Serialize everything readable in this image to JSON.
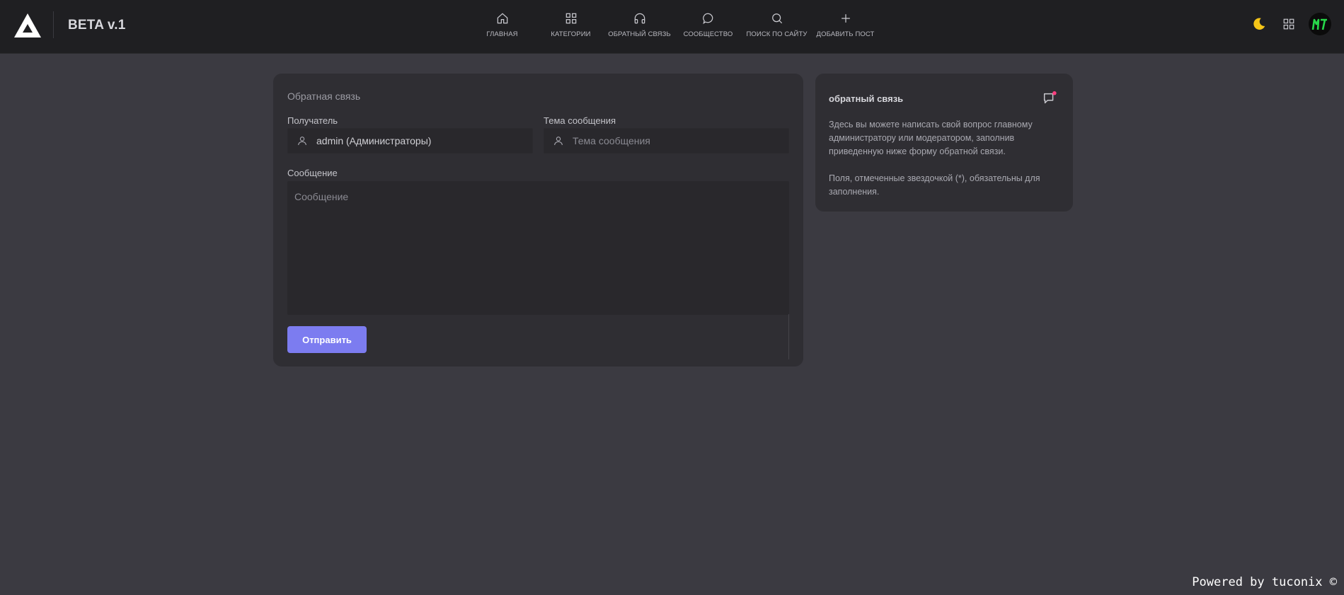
{
  "header": {
    "brand": "BETA v.1",
    "nav": [
      {
        "label": "ГЛАВНАЯ",
        "icon": "home-icon"
      },
      {
        "label": "КАТЕГОРИИ",
        "icon": "grid-icon"
      },
      {
        "label": "ОБРАТНЫЙ СВЯЗЬ",
        "icon": "headphones-icon"
      },
      {
        "label": "СООБЩЕСТВО",
        "icon": "chat-bubble-icon"
      },
      {
        "label": "ПОИСК ПО САЙТУ",
        "icon": "search-icon"
      },
      {
        "label": "ДОБАВИТЬ ПОСТ",
        "icon": "plus-icon"
      }
    ],
    "tools": [
      "moon-icon",
      "apps-grid-icon",
      "avatar"
    ]
  },
  "form": {
    "title": "Обратная связь",
    "recipient_label": "Получатель",
    "recipient_value": "admin (Администраторы)",
    "subject_label": "Тема сообщения",
    "subject_placeholder": "Тема сообщения",
    "message_label": "Сообщение",
    "message_placeholder": "Сообщение",
    "submit_label": "Отправить"
  },
  "side": {
    "title": "обратный связь",
    "paragraph1": "Здесь вы можете написать свой вопрос главному администратору или модератором, заполнив приведенную ниже форму обратной связи.",
    "paragraph2": "Поля, отмеченные звездочкой (*), обязательны для заполнения."
  },
  "footer": {
    "powered": "Powered by tuconix ©"
  },
  "colors": {
    "background": "#3b3a41",
    "header": "#1f1f22",
    "card": "#2f2e33",
    "accent": "#7c7cf0",
    "moon": "#f5c518",
    "notification_dot": "#ff3e7f"
  }
}
